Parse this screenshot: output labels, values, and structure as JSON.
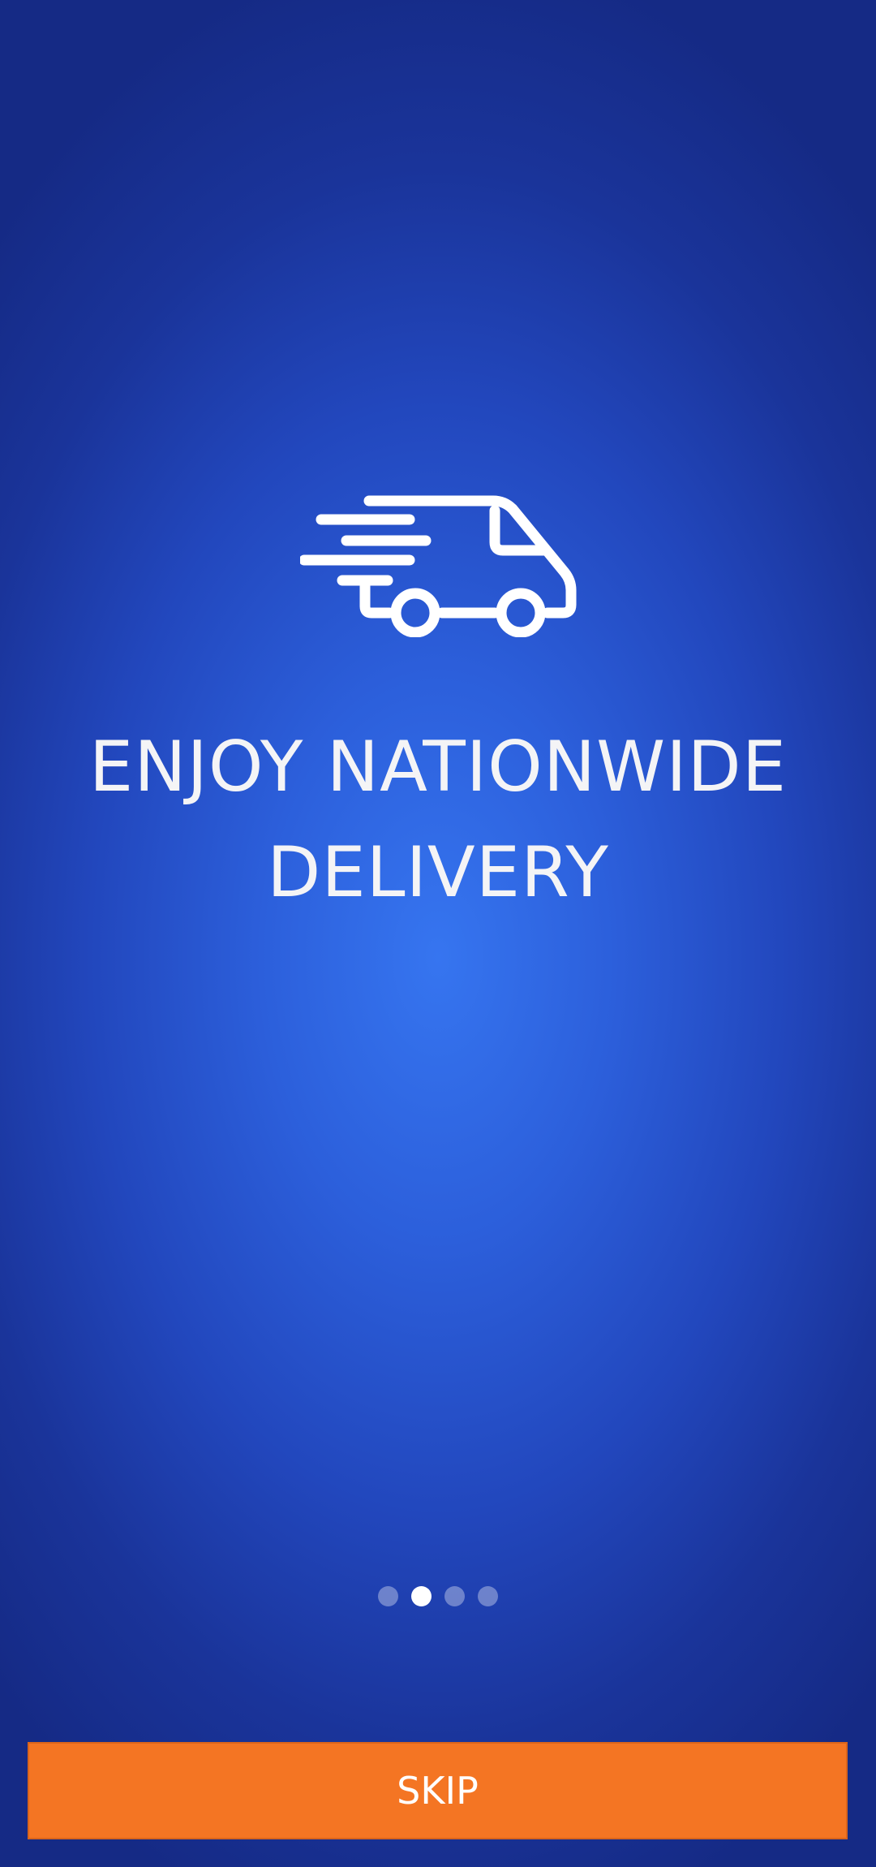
{
  "slide": {
    "icon": "delivery-truck-icon",
    "headline_line1": "ENJOY NATIONWIDE",
    "headline_line2": "DELIVERY"
  },
  "pager": {
    "total": 4,
    "active_index": 1
  },
  "skip_button": {
    "label": "SKIP"
  },
  "colors": {
    "background_center": "#3675f0",
    "background_edge": "#152a85",
    "skip_button": "#f47523",
    "text": "#ffffff"
  }
}
